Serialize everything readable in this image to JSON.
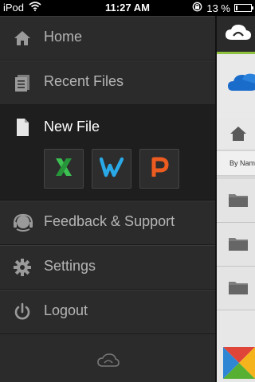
{
  "status_bar": {
    "carrier": "iPod",
    "time": "11:27 AM",
    "battery_percent_text": "13 %",
    "battery_level": 0.13
  },
  "sidebar": {
    "items": [
      {
        "label": "Home",
        "icon": "home-icon"
      },
      {
        "label": "Recent Files",
        "icon": "recent-files-icon"
      },
      {
        "label": "New File",
        "icon": "new-file-icon"
      },
      {
        "label": "Feedback & Support",
        "icon": "feedback-icon"
      },
      {
        "label": "Settings",
        "icon": "gear-icon"
      },
      {
        "label": "Logout",
        "icon": "power-icon"
      }
    ],
    "new_file_apps": [
      {
        "name": "excel",
        "letter": "X",
        "color": "#2fb34a"
      },
      {
        "name": "word",
        "letter": "W",
        "color": "#27a7e5"
      },
      {
        "name": "powerpoint",
        "letter": "P",
        "color": "#ea5a1f"
      }
    ],
    "footer_icon": "cloud-icon"
  },
  "right_panel": {
    "sort_label": "By Nam",
    "accent": "#8ec23f"
  }
}
